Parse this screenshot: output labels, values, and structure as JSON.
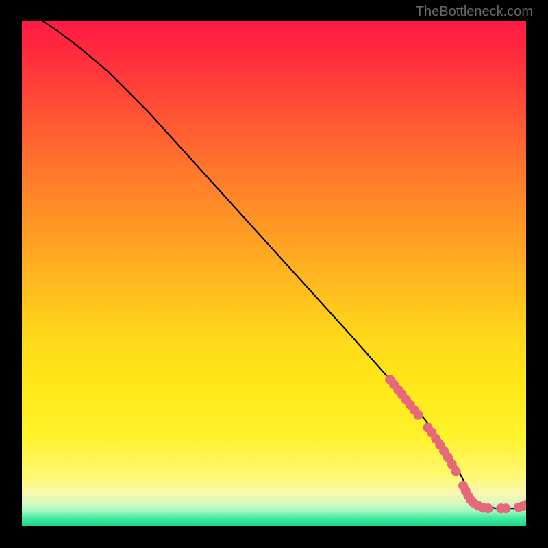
{
  "watermark": "TheBottleneck.com",
  "chart_data": {
    "type": "line",
    "title": "",
    "xlabel": "",
    "ylabel": "",
    "xlim": [
      0,
      100
    ],
    "ylim": [
      0,
      100
    ],
    "grid": false,
    "series": [
      {
        "name": "curve",
        "x": [
          4,
          7,
          11,
          17,
          25,
          35,
          45,
          55,
          65,
          73,
          80,
          83,
          86,
          90,
          94,
          98,
          100
        ],
        "y": [
          100,
          98,
          95,
          90,
          82,
          71,
          60,
          49,
          38,
          29,
          21,
          17,
          12,
          4.5,
          3.5,
          3.5,
          4.2
        ]
      }
    ],
    "markers": [
      {
        "x": 73.0,
        "y": 29.0
      },
      {
        "x": 73.8,
        "y": 28.0
      },
      {
        "x": 74.6,
        "y": 27.0
      },
      {
        "x": 75.4,
        "y": 26.0
      },
      {
        "x": 76.2,
        "y": 25.0
      },
      {
        "x": 77.0,
        "y": 24.0
      },
      {
        "x": 77.8,
        "y": 23.0
      },
      {
        "x": 78.6,
        "y": 22.0
      },
      {
        "x": 80.5,
        "y": 19.5
      },
      {
        "x": 81.3,
        "y": 18.5
      },
      {
        "x": 82.1,
        "y": 17.3
      },
      {
        "x": 82.9,
        "y": 16.1
      },
      {
        "x": 83.7,
        "y": 14.9
      },
      {
        "x": 84.5,
        "y": 13.6
      },
      {
        "x": 85.3,
        "y": 12.2
      },
      {
        "x": 86.1,
        "y": 10.8
      },
      {
        "x": 87.5,
        "y": 8.0
      },
      {
        "x": 88.0,
        "y": 7.0
      },
      {
        "x": 88.5,
        "y": 6.0
      },
      {
        "x": 89.0,
        "y": 5.2
      },
      {
        "x": 89.6,
        "y": 4.6
      },
      {
        "x": 90.5,
        "y": 4.0
      },
      {
        "x": 91.5,
        "y": 3.6
      },
      {
        "x": 92.5,
        "y": 3.5
      },
      {
        "x": 95.0,
        "y": 3.5
      },
      {
        "x": 96.0,
        "y": 3.5
      },
      {
        "x": 98.5,
        "y": 3.7
      },
      {
        "x": 99.3,
        "y": 3.9
      },
      {
        "x": 100.0,
        "y": 4.2
      }
    ],
    "colors": {
      "curve": "#000000",
      "marker": "#e6687a"
    }
  }
}
